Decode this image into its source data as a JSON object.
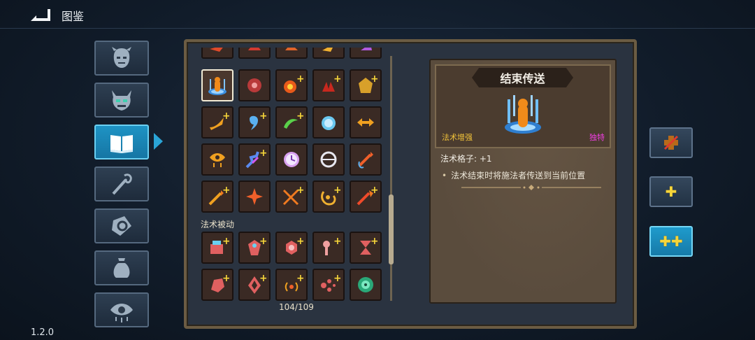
{
  "header": {
    "title": "图鉴"
  },
  "version": "1.2.0",
  "categories": [
    {
      "icon": "face-icon",
      "active": false
    },
    {
      "icon": "demon-mask-icon",
      "active": false
    },
    {
      "icon": "book-icon",
      "active": true
    },
    {
      "icon": "staff-icon",
      "active": false
    },
    {
      "icon": "hand-scroll-icon",
      "active": false
    },
    {
      "icon": "potion-bag-icon",
      "active": false
    },
    {
      "icon": "eye-icon",
      "active": false
    }
  ],
  "grid": {
    "section_label": "法术被动",
    "counter": "104/109"
  },
  "detail": {
    "name": "结束传送",
    "type": "法术增强",
    "rarity": "独特",
    "slots": "法术格子: +1",
    "effect": "法术结束时将施法者传送到当前位置"
  },
  "colors": {
    "accent": "#1e93c4",
    "parchment": "#5a4c3d",
    "type_label": "#f0c23a",
    "rarity_label": "#ee3ee0"
  },
  "right_buttons": [
    {
      "icon": "cross-out-plus-icon",
      "active": false
    },
    {
      "icon": "plus-icon",
      "active": false
    },
    {
      "icon": "double-plus-icon",
      "active": true
    }
  ]
}
